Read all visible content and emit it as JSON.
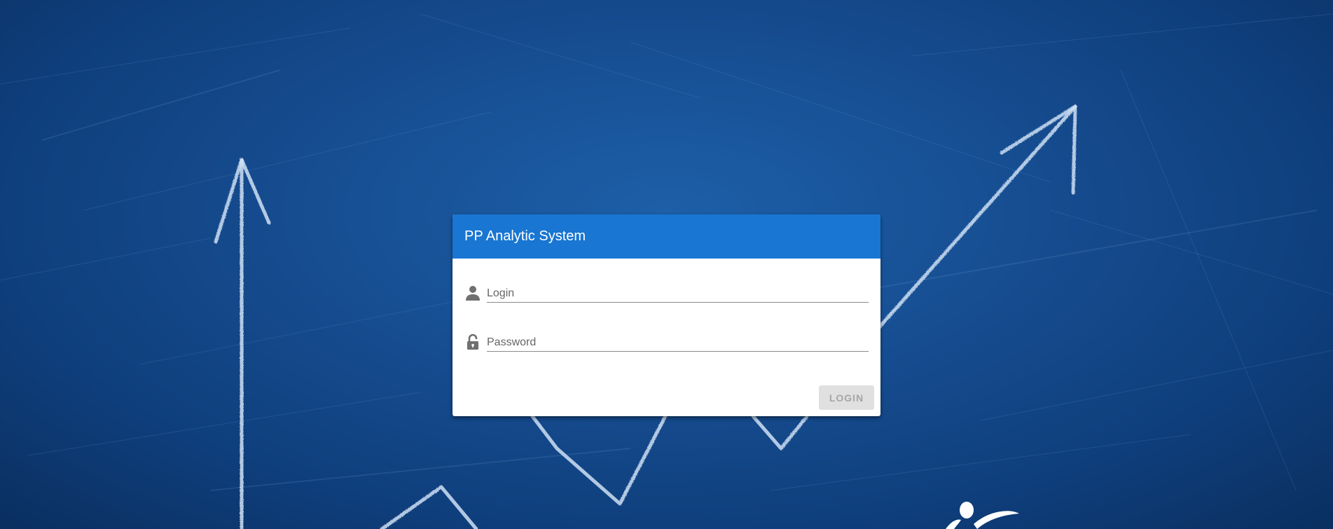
{
  "app": {
    "title": "PP Analytic System"
  },
  "form": {
    "login": {
      "placeholder": "Login",
      "value": "",
      "icon": "user-icon"
    },
    "password": {
      "placeholder": "Password",
      "value": "",
      "icon": "lock-open-icon"
    },
    "submit_label": "LOGIN",
    "submit_disabled": true
  },
  "colors": {
    "header": "#1976d2",
    "background": "#174f93",
    "button_disabled_bg": "#e0e0e0",
    "button_disabled_text": "#a6a6a6",
    "icon": "#707070"
  },
  "background": {
    "description_icon": "chalkboard-arrow-chart"
  }
}
